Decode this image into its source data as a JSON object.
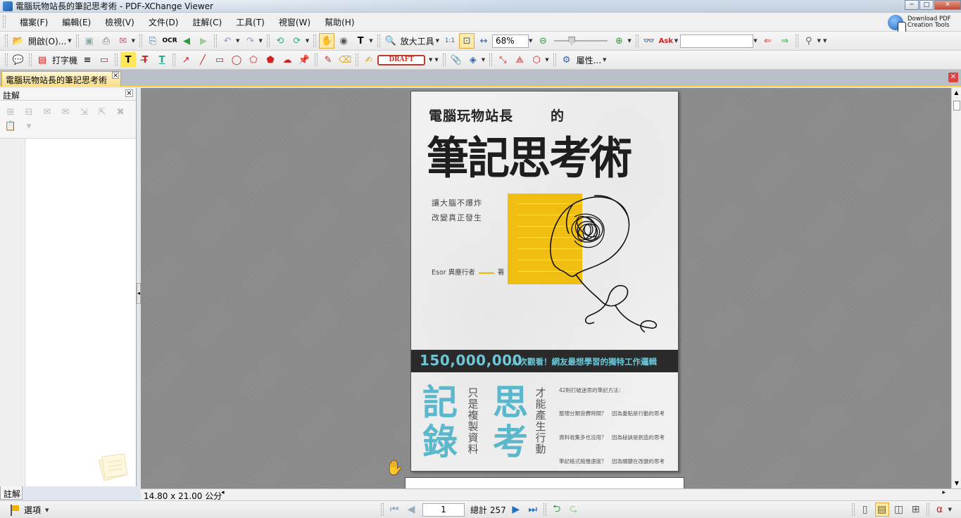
{
  "window": {
    "title": "電腦玩物站長的筆記思考術 - PDF-XChange Viewer",
    "controls": {
      "minimize": "─",
      "maximize": "□",
      "close": "✕"
    }
  },
  "menu": {
    "items": [
      "檔案(F)",
      "編輯(E)",
      "檢視(V)",
      "文件(D)",
      "註解(C)",
      "工具(T)",
      "視窗(W)",
      "幫助(H)"
    ],
    "promo_line1": "Download PDF",
    "promo_line2": "Creation Tools"
  },
  "toolbar1": {
    "open_label": "開啟(O)...",
    "zoom_tool_label": "放大工具",
    "zoom_value": "68%",
    "search_value": ""
  },
  "toolbar2": {
    "typewriter_label": "打字機",
    "draft_stamp": "DRAFT",
    "properties_label": "屬性..."
  },
  "document_tab": {
    "label": "電腦玩物站長的筆記思考術"
  },
  "side_panel": {
    "title": "註解",
    "bottom_tab": "註解"
  },
  "cover": {
    "subtitle": "電腦玩物站長",
    "particle": "的",
    "title": "筆記思考術",
    "tagline1": "讓大腦不爆炸",
    "tagline2": "改變真正發生",
    "author": "Esor 異塵行者",
    "author_suffix": "著",
    "views_number": "150,000,000",
    "views_text": "人次觀看！網友最想學習的獨特工作邏輯",
    "big_left": "記錄",
    "vert_left": "只是複製資料",
    "big_right": "思考",
    "vert_right": "才能產生行動",
    "method_heading": "42則打破迷思的筆記方法：",
    "method1": "整理分類浪費時間？　因為重點是行動的思考",
    "method2": "資料收集多也沒用？　因為秘訣是創造的思考",
    "method3": "筆記格式拖慢速度？　因為關鍵在改變的思考"
  },
  "status": {
    "page_size": "14.80 x 21.00 公分"
  },
  "bottom": {
    "options_label": "選項",
    "current_page": "1",
    "total_pages": "總計 257"
  }
}
